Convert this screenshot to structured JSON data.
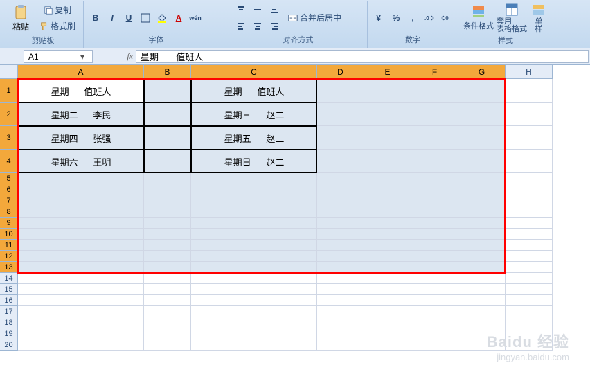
{
  "ribbon": {
    "clipboard": {
      "paste": "粘贴",
      "copy": "复制",
      "format_painter": "格式刷",
      "label": "剪贴板"
    },
    "font": {
      "bold": "B",
      "italic": "I",
      "underline": "U",
      "label": "字体"
    },
    "alignment": {
      "merge_center": "合并后居中",
      "label": "对齐方式"
    },
    "number": {
      "percent": "%",
      "comma": ",",
      "label": "数字"
    },
    "styles": {
      "conditional": "条件格式",
      "table_format": "套用\n表格格式",
      "cell_styles": "单\n样",
      "label": "样式"
    }
  },
  "formula_bar": {
    "namebox": "A1",
    "fx": "fx",
    "formula_value": "星期       值班人"
  },
  "columns": [
    {
      "letter": "A",
      "width": 182
    },
    {
      "letter": "B",
      "width": 68
    },
    {
      "letter": "C",
      "width": 182
    },
    {
      "letter": "D",
      "width": 68
    },
    {
      "letter": "E",
      "width": 68
    },
    {
      "letter": "F",
      "width": 68
    },
    {
      "letter": "G",
      "width": 68
    },
    {
      "letter": "H",
      "width": 68
    }
  ],
  "rows": [
    {
      "n": 1,
      "h": 34
    },
    {
      "n": 2,
      "h": 34
    },
    {
      "n": 3,
      "h": 34
    },
    {
      "n": 4,
      "h": 34
    },
    {
      "n": 5,
      "h": 16
    },
    {
      "n": 6,
      "h": 16
    },
    {
      "n": 7,
      "h": 16
    },
    {
      "n": 8,
      "h": 16
    },
    {
      "n": 9,
      "h": 16
    },
    {
      "n": 10,
      "h": 16
    },
    {
      "n": 11,
      "h": 16
    },
    {
      "n": 12,
      "h": 16
    },
    {
      "n": 13,
      "h": 16
    },
    {
      "n": 14,
      "h": 16
    },
    {
      "n": 15,
      "h": 16
    },
    {
      "n": 16,
      "h": 16
    },
    {
      "n": 17,
      "h": 16
    },
    {
      "n": 18,
      "h": 16
    },
    {
      "n": 19,
      "h": 16
    },
    {
      "n": 20,
      "h": 16
    }
  ],
  "active_cell": "A1",
  "selection": {
    "r1": 1,
    "c1": 1,
    "r2": 13,
    "c2": 7
  },
  "cell_data": {
    "A1": "星期      值班人",
    "A2": "星期二      李民",
    "A3": "星期四      张强",
    "A4": "星期六      王明",
    "C1": "星期      值班人",
    "C2": "星期三      赵二",
    "C3": "星期五      赵二",
    "C4": "星期日      赵二"
  },
  "bordered_cells": [
    "A1",
    "A2",
    "A3",
    "A4",
    "B1",
    "B2",
    "B3",
    "B4",
    "C1",
    "C2",
    "C3",
    "C4"
  ],
  "watermark": {
    "brand": "Baidu 经验",
    "url": "jingyan.baidu.com"
  }
}
